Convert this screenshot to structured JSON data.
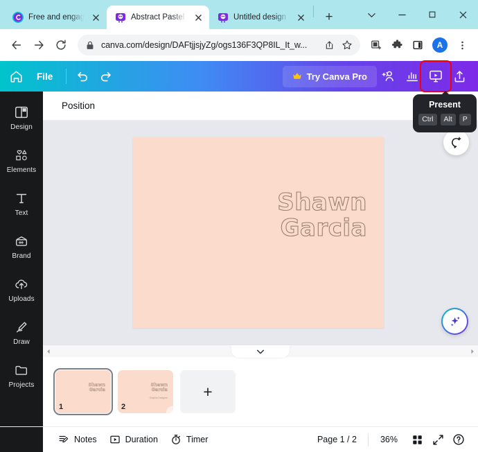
{
  "browser": {
    "tabs": [
      {
        "title": "Free and engag",
        "favicon": "canva-circle-icon",
        "active": false
      },
      {
        "title": "Abstract Pastel",
        "favicon": "canva-icon",
        "active": true
      },
      {
        "title": "Untitled design",
        "favicon": "canva-icon",
        "active": false
      }
    ],
    "new_tab_label": "+",
    "window_controls": {
      "dropdown": "chevron-down-icon",
      "minimize": "minimize-icon",
      "maximize": "maximize-icon",
      "close": "close-icon"
    },
    "nav": {
      "back": "back-arrow-icon",
      "forward": "forward-arrow-icon",
      "reload": "reload-icon"
    },
    "omnibox": {
      "url": "canva.com/design/DAFtjjsjyZg/ogs136F3QP8IL_It_w...",
      "lock": "lock-icon",
      "share": "share-icon",
      "bookmark": "star-icon"
    },
    "toolbar_icons": [
      "reading-list-icon",
      "extensions-puzzle-icon",
      "side-panel-icon"
    ],
    "profile_initial": "A",
    "menu": "three-dot-menu-icon",
    "tabstrip_color": "#aee6ee"
  },
  "canva": {
    "topbar": {
      "home": "home-icon",
      "file_label": "File",
      "undo": "undo-icon",
      "redo": "redo-icon",
      "pro_label": "Try Canva Pro",
      "pro_crown": "crown-icon",
      "share_people": "add-collaborator-icon",
      "insights": "insights-chart-icon",
      "present": "present-icon",
      "export": "share-export-icon",
      "gradient_from": "#00c4cc",
      "gradient_to": "#7d2ae8",
      "highlight_color": "#f3000d"
    },
    "tooltip": {
      "title": "Present",
      "keys": [
        "Ctrl",
        "Alt",
        "P"
      ]
    },
    "sidebar": {
      "items": [
        {
          "label": "Design",
          "icon": "design-layout-icon"
        },
        {
          "label": "Elements",
          "icon": "elements-shapes-icon"
        },
        {
          "label": "Text",
          "icon": "text-t-icon"
        },
        {
          "label": "Brand",
          "icon": "brand-wallet-icon"
        },
        {
          "label": "Uploads",
          "icon": "upload-cloud-icon"
        },
        {
          "label": "Draw",
          "icon": "draw-pen-icon"
        },
        {
          "label": "Projects",
          "icon": "folder-icon"
        }
      ]
    },
    "position_bar": {
      "label": "Position"
    },
    "canvas": {
      "background_color": "#fadbcc",
      "title_line1": "Shawn",
      "title_line2": "Garcia",
      "comment_button": "add-comment-icon",
      "magic_button": "magic-sparkles-icon"
    },
    "pages_panel": {
      "scroll_left": "scroll-left-arrow-icon",
      "scroll_right": "scroll-right-arrow-icon",
      "collapse": "chevron-down-icon",
      "pages": [
        {
          "number": "1",
          "text_line1": "Shawn",
          "text_line2": "Garcia",
          "subtitle": "",
          "selected": true
        },
        {
          "number": "2",
          "text_line1": "Shawn",
          "text_line2": "Garcia",
          "subtitle": "Graphic Designer",
          "selected": false
        }
      ],
      "add_page_label": "+"
    },
    "statusbar": {
      "notes_label": "Notes",
      "notes_icon": "notes-icon",
      "duration_label": "Duration",
      "duration_icon": "duration-play-icon",
      "timer_label": "Timer",
      "timer_icon": "timer-stopwatch-icon",
      "page_indicator": "Page 1 / 2",
      "zoom_level": "36%",
      "grid_icon": "grid-view-icon",
      "fullscreen_icon": "expand-fullscreen-icon",
      "help_icon": "help-question-icon"
    }
  }
}
